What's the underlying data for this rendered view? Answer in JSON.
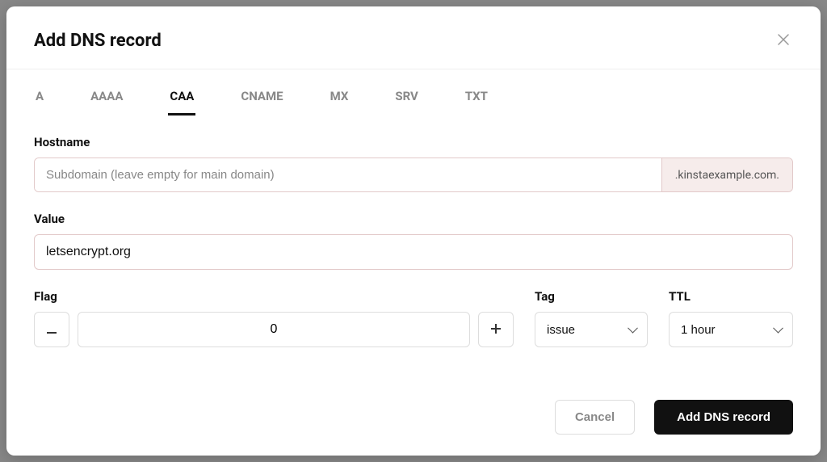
{
  "modal": {
    "title": "Add DNS record"
  },
  "tabs": [
    {
      "label": "A",
      "active": false
    },
    {
      "label": "AAAA",
      "active": false
    },
    {
      "label": "CAA",
      "active": true
    },
    {
      "label": "CNAME",
      "active": false
    },
    {
      "label": "MX",
      "active": false
    },
    {
      "label": "SRV",
      "active": false
    },
    {
      "label": "TXT",
      "active": false
    }
  ],
  "hostname": {
    "label": "Hostname",
    "placeholder": "Subdomain (leave empty for main domain)",
    "value": "",
    "suffix": ".kinstaexample.com."
  },
  "value": {
    "label": "Value",
    "value": "letsencrypt.org"
  },
  "flag": {
    "label": "Flag",
    "value": "0"
  },
  "tag": {
    "label": "Tag",
    "selected": "issue"
  },
  "ttl": {
    "label": "TTL",
    "selected": "1 hour"
  },
  "buttons": {
    "cancel": "Cancel",
    "submit": "Add DNS record"
  }
}
